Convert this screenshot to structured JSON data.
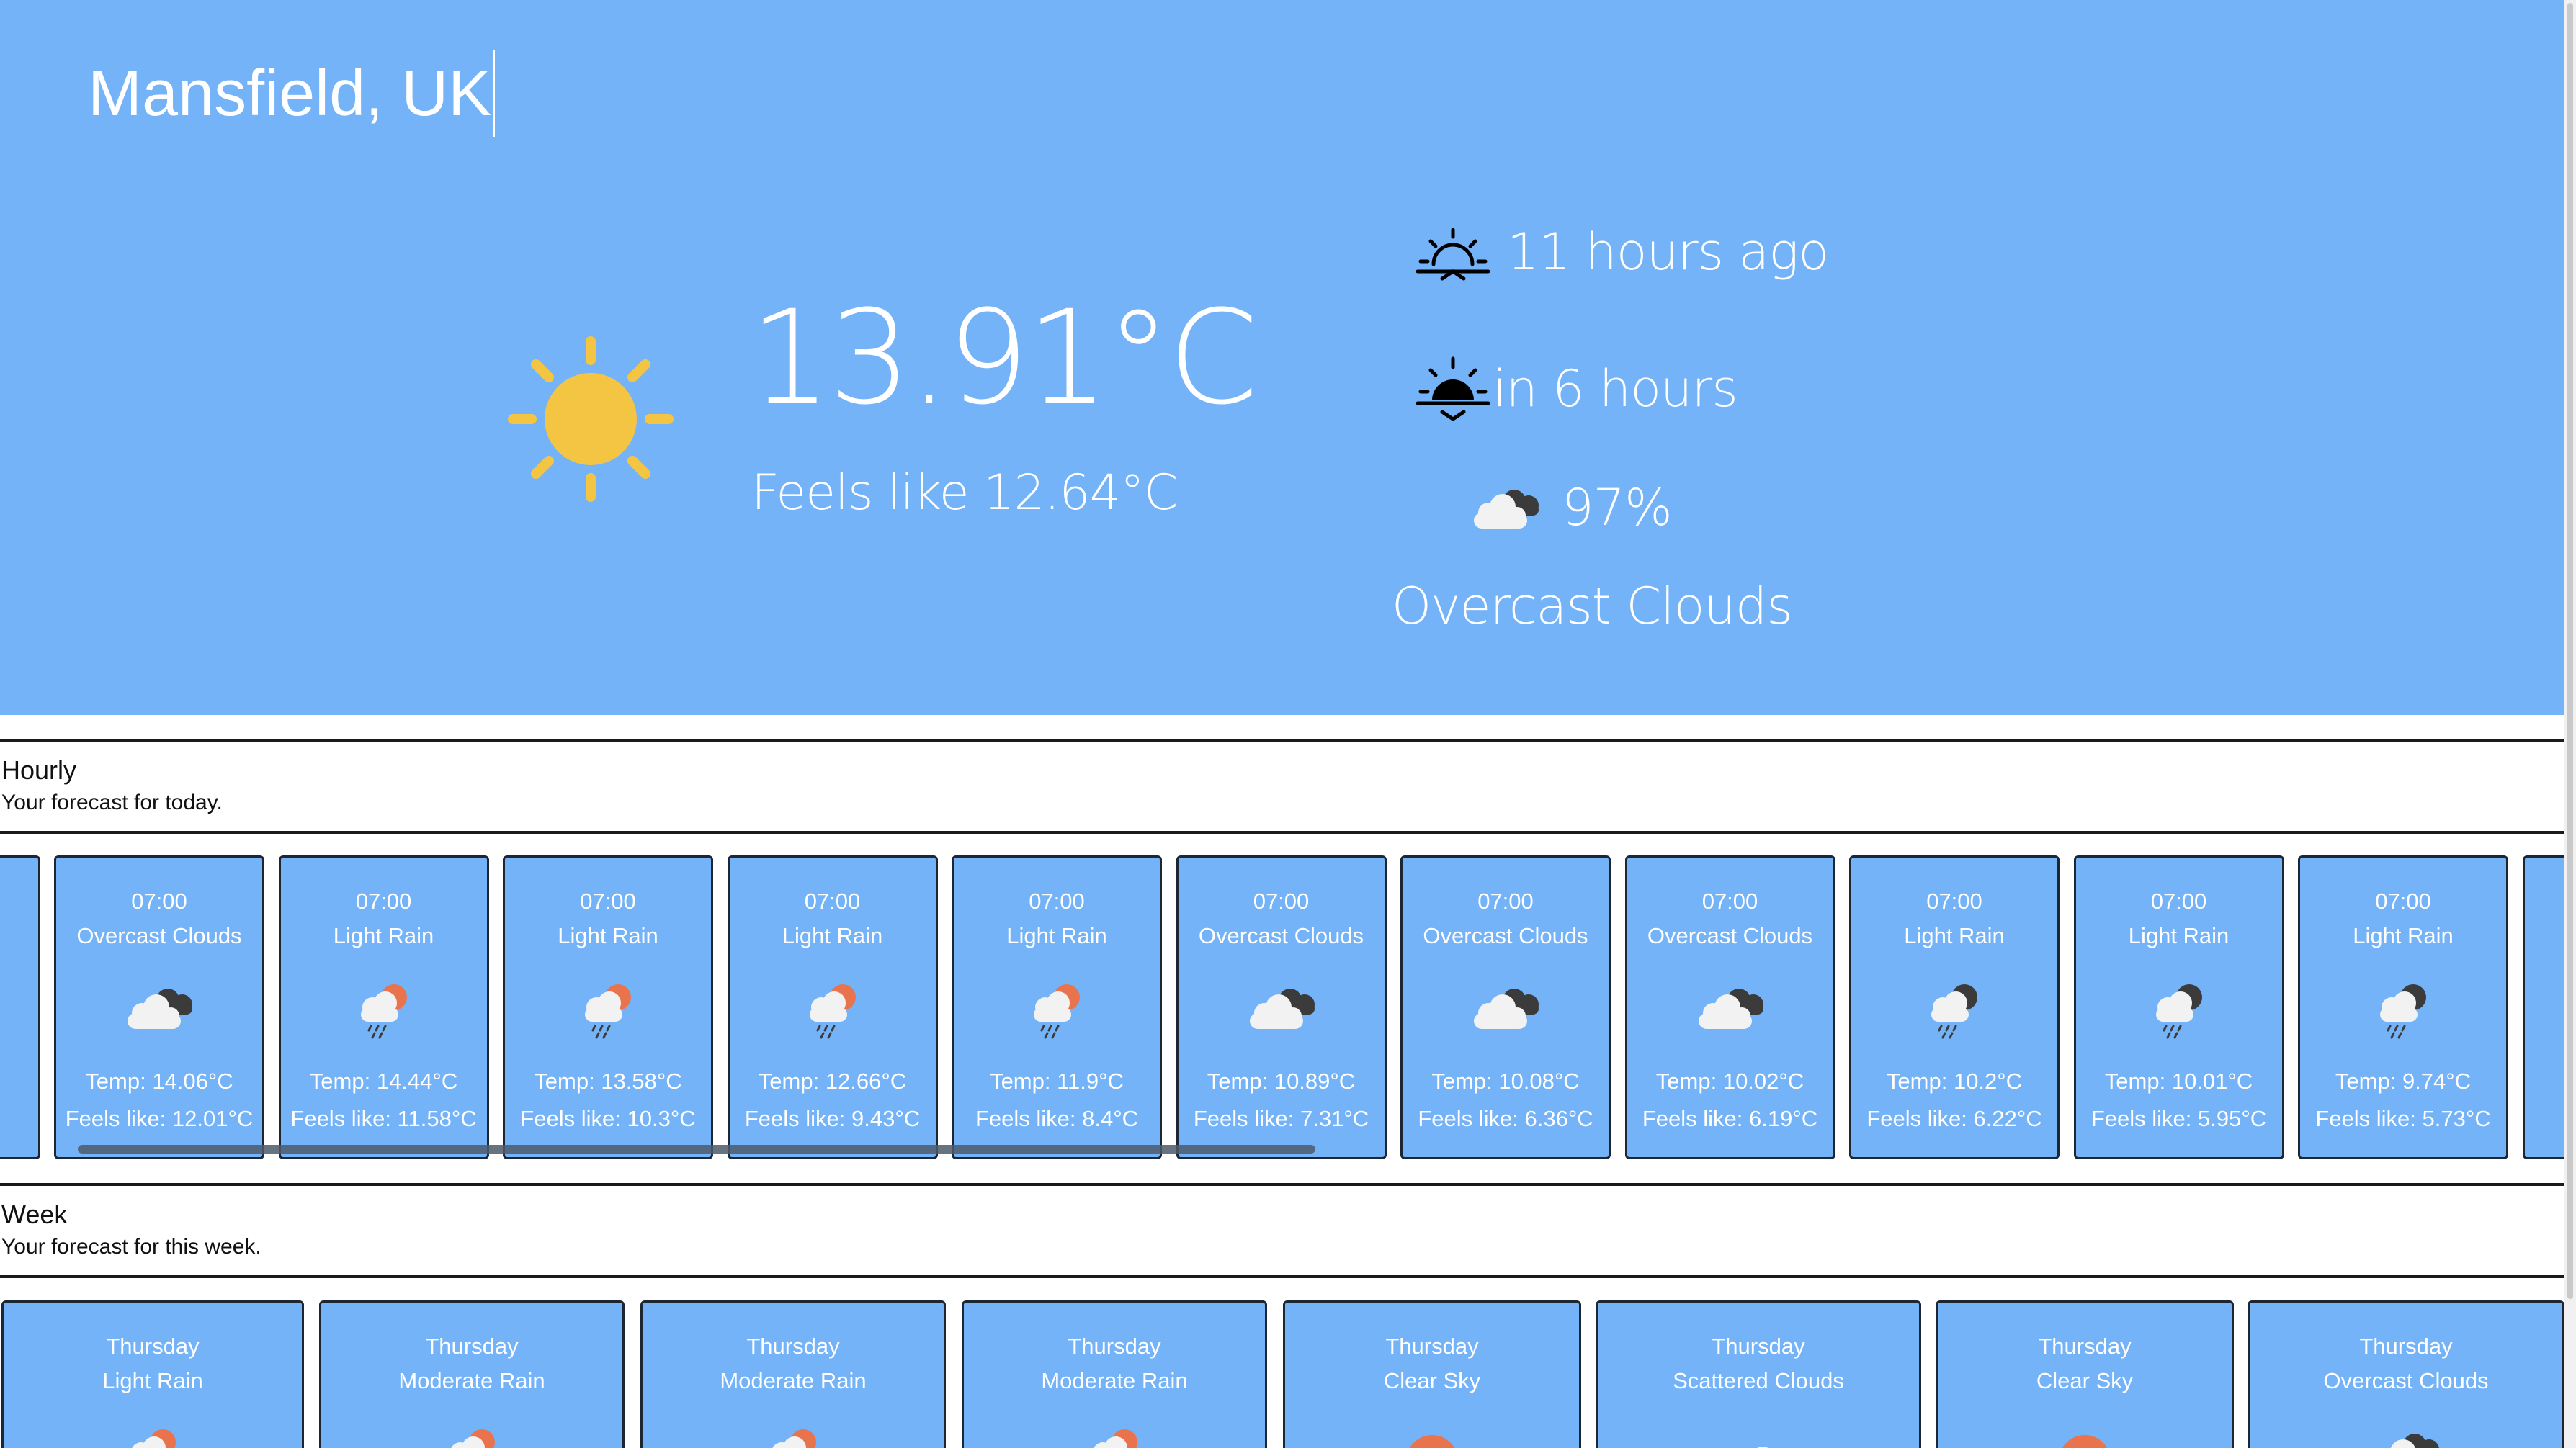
{
  "location": "Mansfield, UK",
  "current": {
    "temperature": "13.91°C",
    "feels_like": "Feels like 12.64°C",
    "sunrise": "11 hours ago",
    "sunset": "in 6 hours",
    "cloudiness": "97%",
    "description": "Overcast Clouds",
    "icon": "sun-icon"
  },
  "hourly": {
    "title": "Hourly",
    "subtitle": "Your forecast for today.",
    "cards": [
      {
        "time": "07:00",
        "desc": "Overcast Clouds",
        "icon": "overcast-clouds-icon",
        "temp": "Temp: 14.06°C",
        "feels": "Feels like: 12.01°C"
      },
      {
        "time": "07:00",
        "desc": "Light Rain",
        "icon": "rain-sun-icon",
        "temp": "Temp: 14.44°C",
        "feels": "Feels like: 11.58°C"
      },
      {
        "time": "07:00",
        "desc": "Light Rain",
        "icon": "rain-sun-icon",
        "temp": "Temp: 13.58°C",
        "feels": "Feels like: 10.3°C"
      },
      {
        "time": "07:00",
        "desc": "Light Rain",
        "icon": "rain-sun-icon",
        "temp": "Temp: 12.66°C",
        "feels": "Feels like: 9.43°C"
      },
      {
        "time": "07:00",
        "desc": "Light Rain",
        "icon": "rain-sun-icon",
        "temp": "Temp: 11.9°C",
        "feels": "Feels like: 8.4°C"
      },
      {
        "time": "07:00",
        "desc": "Overcast Clouds",
        "icon": "overcast-clouds-icon",
        "temp": "Temp: 10.89°C",
        "feels": "Feels like: 7.31°C"
      },
      {
        "time": "07:00",
        "desc": "Overcast Clouds",
        "icon": "overcast-clouds-icon",
        "temp": "Temp: 10.08°C",
        "feels": "Feels like: 6.36°C"
      },
      {
        "time": "07:00",
        "desc": "Overcast Clouds",
        "icon": "overcast-clouds-icon",
        "temp": "Temp: 10.02°C",
        "feels": "Feels like: 6.19°C"
      },
      {
        "time": "07:00",
        "desc": "Light Rain",
        "icon": "rain-night-icon",
        "temp": "Temp: 10.2°C",
        "feels": "Feels like: 6.22°C"
      },
      {
        "time": "07:00",
        "desc": "Light Rain",
        "icon": "rain-night-icon",
        "temp": "Temp: 10.01°C",
        "feels": "Feels like: 5.95°C"
      },
      {
        "time": "07:00",
        "desc": "Light Rain",
        "icon": "rain-night-icon",
        "temp": "Temp: 9.74°C",
        "feels": "Feels like: 5.73°C"
      }
    ]
  },
  "week": {
    "title": "Week",
    "subtitle": "Your forecast for this week.",
    "cards": [
      {
        "day": "Thursday",
        "desc": "Light Rain",
        "icon": "rain-sun-icon"
      },
      {
        "day": "Thursday",
        "desc": "Moderate Rain",
        "icon": "rain-sun-icon"
      },
      {
        "day": "Thursday",
        "desc": "Moderate Rain",
        "icon": "rain-sun-icon"
      },
      {
        "day": "Thursday",
        "desc": "Moderate Rain",
        "icon": "rain-sun-icon"
      },
      {
        "day": "Thursday",
        "desc": "Clear Sky",
        "icon": "clear-sky-icon"
      },
      {
        "day": "Thursday",
        "desc": "Scattered Clouds",
        "icon": "scattered-clouds-icon"
      },
      {
        "day": "Thursday",
        "desc": "Clear Sky",
        "icon": "clear-sky-icon"
      },
      {
        "day": "Thursday",
        "desc": "Overcast Clouds",
        "icon": "overcast-clouds-icon"
      }
    ]
  },
  "colors": {
    "hero_bg": "#74b3f7",
    "sun": "#f4c542",
    "card_border": "#1c2733"
  }
}
